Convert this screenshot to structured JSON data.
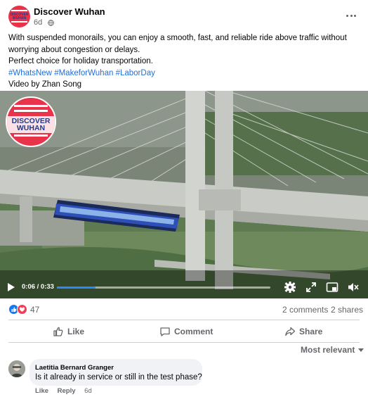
{
  "post": {
    "page_name": "Discover Wuhan",
    "time": "6d",
    "avatar_text": "DISCOVER WUHAN",
    "body_line1": "With suspended monorails, you can enjoy a smooth, fast, and reliable ride above traffic without worrying about congestion or delays.",
    "body_line2": "Perfect choice for holiday transportation.",
    "hashtags": [
      "#WhatsNew",
      "#MakeforWuhan",
      "#LaborDay"
    ],
    "credit": "Video by Zhan Song"
  },
  "video": {
    "logo_text": "DISCOVER WUHAN",
    "current_time": "0:06",
    "duration": "0:33",
    "time_readout": "0:06 / 0:33",
    "progress_fraction": 0.18,
    "icons": [
      "play-icon",
      "settings-icon",
      "fullscreen-icon",
      "picture-in-picture-icon",
      "volume-muted-icon"
    ]
  },
  "engagement": {
    "reactions": [
      "like-icon",
      "love-icon"
    ],
    "reaction_count": "47",
    "comments": "2 comments",
    "shares": "2 shares"
  },
  "actions": {
    "like": "Like",
    "comment": "Comment",
    "share": "Share"
  },
  "comments_section": {
    "sort_label": "Most relevant",
    "comment": {
      "author": "Laetitia Bernard Granger",
      "text": "Is it already in service or still in the test phase?",
      "like": "Like",
      "reply": "Reply",
      "time": "6d"
    }
  },
  "colors": {
    "brand_red": "#e8334a",
    "link_blue": "#216fdb",
    "progress_blue": "#2d88ff",
    "muted_text": "#65676b"
  }
}
